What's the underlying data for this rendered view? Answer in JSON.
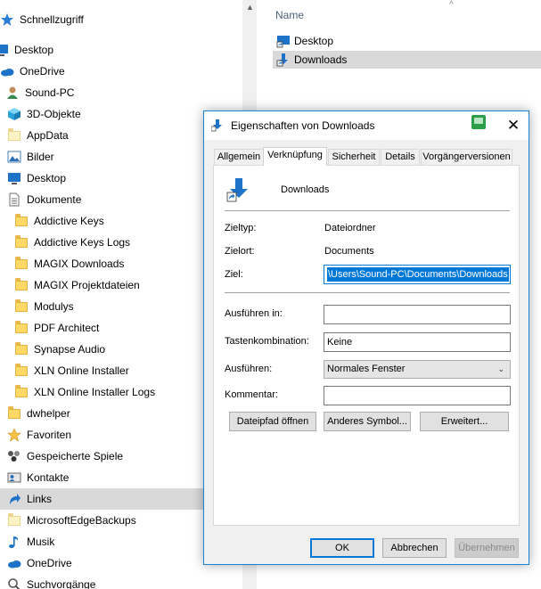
{
  "nav": {
    "items": [
      {
        "label": "Schnellzugriff",
        "icon": "star-icon"
      },
      {
        "label": "Desktop",
        "icon": "desktop-icon"
      },
      {
        "label": "OneDrive",
        "icon": "cloud-icon"
      },
      {
        "label": "Sound-PC",
        "icon": "user-icon"
      },
      {
        "label": "3D-Objekte",
        "icon": "cube-icon"
      },
      {
        "label": "AppData",
        "icon": "folder-icon"
      },
      {
        "label": "Bilder",
        "icon": "pictures-icon"
      },
      {
        "label": "Desktop",
        "icon": "desktop-icon"
      },
      {
        "label": "Dokumente",
        "icon": "document-icon"
      },
      {
        "label": "Addictive Keys",
        "icon": "folder-icon"
      },
      {
        "label": "Addictive Keys Logs",
        "icon": "folder-icon"
      },
      {
        "label": "MAGIX Downloads",
        "icon": "folder-icon"
      },
      {
        "label": "MAGIX Projektdateien",
        "icon": "folder-icon"
      },
      {
        "label": "Modulys",
        "icon": "folder-icon"
      },
      {
        "label": "PDF Architect",
        "icon": "folder-icon"
      },
      {
        "label": "Synapse Audio",
        "icon": "folder-icon"
      },
      {
        "label": "XLN Online Installer",
        "icon": "folder-icon"
      },
      {
        "label": "XLN Online Installer Logs",
        "icon": "folder-icon"
      },
      {
        "label": "dwhelper",
        "icon": "folder-icon"
      },
      {
        "label": "Favoriten",
        "icon": "star-icon"
      },
      {
        "label": "Gespeicherte Spiele",
        "icon": "games-icon"
      },
      {
        "label": "Kontakte",
        "icon": "contacts-icon"
      },
      {
        "label": "Links",
        "icon": "link-icon"
      },
      {
        "label": "MicrosoftEdgeBackups",
        "icon": "folder-icon"
      },
      {
        "label": "Musik",
        "icon": "music-icon"
      },
      {
        "label": "OneDrive",
        "icon": "cloud-icon"
      },
      {
        "label": "Suchvorgänge",
        "icon": "search-icon"
      }
    ]
  },
  "list": {
    "column_name": "Name",
    "items": [
      {
        "label": "Desktop"
      },
      {
        "label": "Downloads"
      }
    ]
  },
  "dialog": {
    "title": "Eigenschaften von Downloads",
    "tabs": [
      "Allgemein",
      "Verknüpfung",
      "Sicherheit",
      "Details",
      "Vorgängerversionen"
    ],
    "name": "Downloads",
    "zieltyp_label": "Zieltyp:",
    "zieltyp_value": "Dateiordner",
    "zielort_label": "Zielort:",
    "zielort_value": "Documents",
    "ziel_label": "Ziel:",
    "ziel_value": "\\Users\\Sound-PC\\Documents\\Downloads",
    "ausfuehren_in_label": "Ausführen in:",
    "ausfuehren_in_value": "",
    "tastenkombination_label": "Tastenkombination:",
    "tastenkombination_value": "Keine",
    "ausfuehren_label": "Ausführen:",
    "ausfuehren_value": "Normales Fenster",
    "kommentar_label": "Kommentar:",
    "kommentar_value": "",
    "btn_dateipfad": "Dateipfad öffnen",
    "btn_symbol": "Anderes Symbol...",
    "btn_erweitert": "Erweitert...",
    "btn_ok": "OK",
    "btn_abbrechen": "Abbrechen",
    "btn_uebernehmen": "Übernehmen"
  },
  "colors": {
    "accent": "#0078d7",
    "selection": "#d9d9d9",
    "dialog_bg": "#f0f0f0"
  }
}
